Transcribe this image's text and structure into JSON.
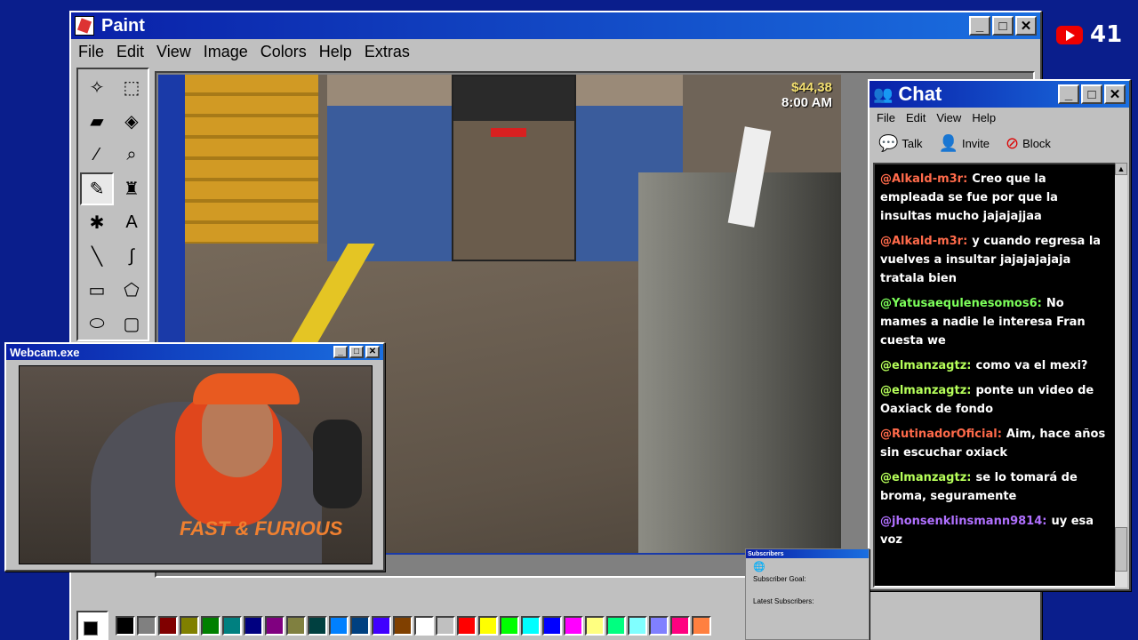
{
  "paint": {
    "title": "Paint",
    "menu": [
      "File",
      "Edit",
      "View",
      "Image",
      "Colors",
      "Help",
      "Extras"
    ],
    "controls": {
      "minimize": "_",
      "maximize": "□",
      "close": "✕"
    },
    "tools": [
      {
        "name": "free-select-icon",
        "glyph": "✧"
      },
      {
        "name": "rect-select-icon",
        "glyph": "⬚"
      },
      {
        "name": "eraser-icon",
        "glyph": "▰"
      },
      {
        "name": "fill-icon",
        "glyph": "◈"
      },
      {
        "name": "picker-icon",
        "glyph": "⁄"
      },
      {
        "name": "magnifier-icon",
        "glyph": "⌕"
      },
      {
        "name": "pencil-icon",
        "glyph": "✎"
      },
      {
        "name": "brush-icon",
        "glyph": "♜"
      },
      {
        "name": "airbrush-icon",
        "glyph": "✱"
      },
      {
        "name": "text-icon",
        "glyph": "A"
      },
      {
        "name": "line-icon",
        "glyph": "╲"
      },
      {
        "name": "curve-icon",
        "glyph": "∫"
      },
      {
        "name": "rectangle-icon",
        "glyph": "▭"
      },
      {
        "name": "polygon-icon",
        "glyph": "⬠"
      },
      {
        "name": "ellipse-icon",
        "glyph": "⬭"
      },
      {
        "name": "rounded-rect-icon",
        "glyph": "▢"
      }
    ],
    "palette": [
      "#000000",
      "#808080",
      "#800000",
      "#808000",
      "#008000",
      "#008080",
      "#000080",
      "#800080",
      "#808040",
      "#004040",
      "#0080ff",
      "#004080",
      "#4000ff",
      "#804000",
      "#ffffff",
      "#c0c0c0",
      "#ff0000",
      "#ffff00",
      "#00ff00",
      "#00ffff",
      "#0000ff",
      "#ff00ff",
      "#ffff80",
      "#00ff80",
      "#80ffff",
      "#8080ff",
      "#ff0080",
      "#ff8040"
    ]
  },
  "game_hud": {
    "money": "$44,38",
    "time": "8:00 AM"
  },
  "youtube": {
    "count": "41"
  },
  "chat": {
    "title": "Chat",
    "menu": [
      "File",
      "Edit",
      "View",
      "Help"
    ],
    "toolbar": {
      "talk": "Talk",
      "invite": "Invite",
      "block": "Block"
    },
    "messages": [
      {
        "user": "@Alkald-m3r:",
        "text": "Creo que la empleada se fue por que la insultas mucho jajajajjaa",
        "color": "#ff6a4a"
      },
      {
        "user": "@Alkald-m3r:",
        "text": "y cuando regresa la vuelves a insultar jajajajajaja tratala bien",
        "color": "#ff6a4a"
      },
      {
        "user": "@Yatusaequlenesomos6:",
        "text": "No mames a nadie le interesa Fran cuesta we",
        "color": "#7cff5a"
      },
      {
        "user": "@elmanzagtz:",
        "text": "como va el mexi?",
        "color": "#b6ff5a"
      },
      {
        "user": "@elmanzagtz:",
        "text": "ponte un video de Oaxiack de fondo",
        "color": "#b6ff5a"
      },
      {
        "user": "@RutinadorOficial:",
        "text": "Aim, hace años sin escuchar oxiack",
        "color": "#ff6a4a"
      },
      {
        "user": "@elmanzagtz:",
        "text": "se lo tomará de broma, seguramente",
        "color": "#b6ff5a"
      },
      {
        "user": "@jhonsenklinsmann9814:",
        "text": "uy esa voz",
        "color": "#b070ff"
      }
    ]
  },
  "webcam": {
    "title": "Webcam.exe",
    "shirt": "FAST & FURIOUS"
  },
  "subscribers": {
    "title": "Subscribers",
    "goal": "Subscriber Goal:",
    "latest": "Latest Subscribers:"
  }
}
